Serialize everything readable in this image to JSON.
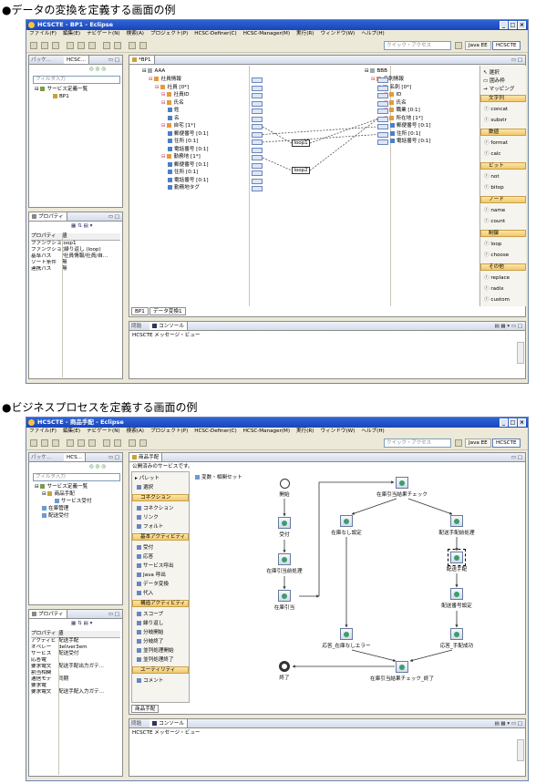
{
  "section1": {
    "heading": "●データの変換を定義する画面の例",
    "window": {
      "title": "HCSCTE - BP1 - Eclipse",
      "controls": [
        "_",
        "□",
        "×"
      ],
      "menu": [
        "ファイル(F)",
        "編集(E)",
        "ナビゲート(N)",
        "検索(A)",
        "プロジェクト(P)",
        "HCSC-Definer(C)",
        "HCSC-Manager(M)",
        "実行(R)",
        "ウィンドウ(W)",
        "ヘルプ(H)"
      ],
      "quick_access_placeholder": "クイック・アクセス",
      "perspectives": [
        "Java EE",
        "HCSCTE"
      ]
    },
    "explorer": {
      "tabs": [
        "パッケ...",
        "HCSC..."
      ],
      "filter_placeholder": "フィルタ入力",
      "tree": [
        "サービス定義一覧",
        "BP1"
      ]
    },
    "properties": {
      "tab": "プロパティ",
      "headers": [
        "プロパティ",
        "値"
      ],
      "rows": [
        [
          "ファンクション名",
          "loop1"
        ],
        [
          "ファンクション",
          "(繰り返し (loop)"
        ],
        [
          "基準パス",
          "/社員情報/社員/自..."
        ],
        [
          "ソート条件",
          "無"
        ],
        [
          "連携パス",
          "無"
        ]
      ]
    },
    "editor": {
      "tab": "*BP1",
      "source_root": "AAA",
      "source_tree": [
        {
          "depth": 1,
          "label": "社員情報"
        },
        {
          "depth": 2,
          "label": "社員 [0*]"
        },
        {
          "depth": 3,
          "label": "社員ID"
        },
        {
          "depth": 3,
          "label": "氏名"
        },
        {
          "depth": 4,
          "label": "姓"
        },
        {
          "depth": 4,
          "label": "名"
        },
        {
          "depth": 3,
          "label": "自宅 [1*]"
        },
        {
          "depth": 4,
          "label": "郵便番号 [0:1]"
        },
        {
          "depth": 4,
          "label": "住所 [0:1]"
        },
        {
          "depth": 4,
          "label": "電話番号 [0:1]"
        },
        {
          "depth": 3,
          "label": "勤務地 [1*]"
        },
        {
          "depth": 4,
          "label": "郵便番号 [0:1]"
        },
        {
          "depth": 4,
          "label": "住所 [0:1]"
        },
        {
          "depth": 4,
          "label": "電話番号 [0:1]"
        },
        {
          "depth": 4,
          "label": "勤務地タグ"
        }
      ],
      "target_root": "BBB",
      "target_tree": [
        {
          "depth": 1,
          "label": "名刺情報"
        },
        {
          "depth": 2,
          "label": "名刺 [0*]"
        },
        {
          "depth": 3,
          "label": "ID"
        },
        {
          "depth": 3,
          "label": "氏名"
        },
        {
          "depth": 3,
          "label": "職業 [0:1]"
        },
        {
          "depth": 3,
          "label": "所在地 [1*]"
        },
        {
          "depth": 4,
          "label": "郵便番号 [0:1]"
        },
        {
          "depth": 4,
          "label": "住所 [0:1]"
        },
        {
          "depth": 4,
          "label": "電話番号 [0:1]"
        }
      ],
      "functions": [
        "loop1",
        "loop2"
      ],
      "bottom_tabs": [
        "BP1",
        "データ変換1"
      ]
    },
    "palette": {
      "top": [
        "選択",
        "囲み枠",
        "マッピング"
      ],
      "groups": [
        {
          "name": "文字列",
          "items": [
            "concat",
            "substr"
          ]
        },
        {
          "name": "数値",
          "items": [
            "format",
            "calc"
          ]
        },
        {
          "name": "ビット",
          "items": [
            "not",
            "bitop"
          ]
        },
        {
          "name": "ノード",
          "items": [
            "name",
            "count"
          ]
        },
        {
          "name": "制御",
          "items": [
            "loop",
            "choose"
          ]
        },
        {
          "name": "その他",
          "items": [
            "replace",
            "radix",
            "custom"
          ]
        }
      ]
    },
    "console": {
      "tabs": [
        "問題",
        "コンソール"
      ],
      "text": "HCSCTE メッセージ・ビュー"
    }
  },
  "section2": {
    "heading": "●ビジネスプロセスを定義する画面の例",
    "window": {
      "title": "HCSCTE - 商品手配 - Eclipse",
      "controls": [
        "_",
        "□",
        "×"
      ],
      "menu": [
        "ファイル(F)",
        "編集(E)",
        "ナビゲート(N)",
        "検索(A)",
        "プロジェクト(P)",
        "HCSC-Definer(C)",
        "HCSC-Manager(M)",
        "実行(R)",
        "ウィンドウ(W)",
        "ヘルプ(H)"
      ],
      "quick_access_placeholder": "クイック・アクセス",
      "perspectives": [
        "Java EE",
        "HCSCTE"
      ]
    },
    "explorer": {
      "tabs": [
        "パッケ...",
        "HCS..."
      ],
      "filter_placeholder": "フィルタ入力",
      "tree": [
        "サービス定義一覧",
        "商品手配",
        "サービス受付",
        "在庫管理",
        "配送受付"
      ]
    },
    "properties": {
      "tab": "プロパティ",
      "headers": [
        "プロパティ",
        "値"
      ],
      "rows": [
        [
          "アクティビ",
          "配送手配"
        ],
        [
          "オペレー",
          "deliver3em"
        ],
        [
          "サービス",
          "配送受付"
        ],
        [
          "応答電",
          ""
        ],
        [
          "要求電文",
          "配送手配出力ガテ..."
        ],
        [
          "割当相関",
          ""
        ],
        [
          "通信モデ",
          "同期"
        ],
        [
          "要求電",
          ""
        ],
        [
          "要求電文",
          "配送手配入力ガテ..."
        ]
      ]
    },
    "editor": {
      "tab": "商品手配",
      "caption": "公開済みのサービスです。",
      "palette_title": "パレット",
      "var_label": "変数・相関セット",
      "palette_sections": [
        {
          "name": "",
          "items": [
            "選択"
          ]
        },
        {
          "name": "コネクション",
          "items": [
            "コネクション",
            "リンク",
            "フォルト"
          ]
        },
        {
          "name": "基本アクティビティ",
          "items": [
            "受付",
            "応答",
            "サービス呼出",
            "Java 呼出",
            "データ変換",
            "代入"
          ]
        },
        {
          "name": "構造アクティビティ",
          "items": [
            "スコープ",
            "繰り返し",
            "分岐開始",
            "分岐終了",
            "並列処理開始",
            "並列処理終了"
          ]
        },
        {
          "name": "ユーティリティ",
          "items": [
            "コメント"
          ]
        }
      ],
      "nodes": {
        "start": "開始",
        "receive": "受付",
        "pre": "在庫引当前処理",
        "alloc": "在庫引当",
        "check": "在庫引当結果チェック",
        "nostock_set": "在庫なし設定",
        "pre_delivery": "配送手配前処理",
        "delivery": "配送手配",
        "set_no": "配送番号設定",
        "resp_err": "応答_在庫なしエラー",
        "resp_ok": "応答_手配成功",
        "check_end": "在庫引当結果チェック_終了",
        "end": "終了"
      },
      "bottom_tab": "商品手配"
    },
    "console": {
      "tabs": [
        "問題",
        "コンソール"
      ],
      "text": "HCSCTE メッセージ・ビュー"
    }
  }
}
